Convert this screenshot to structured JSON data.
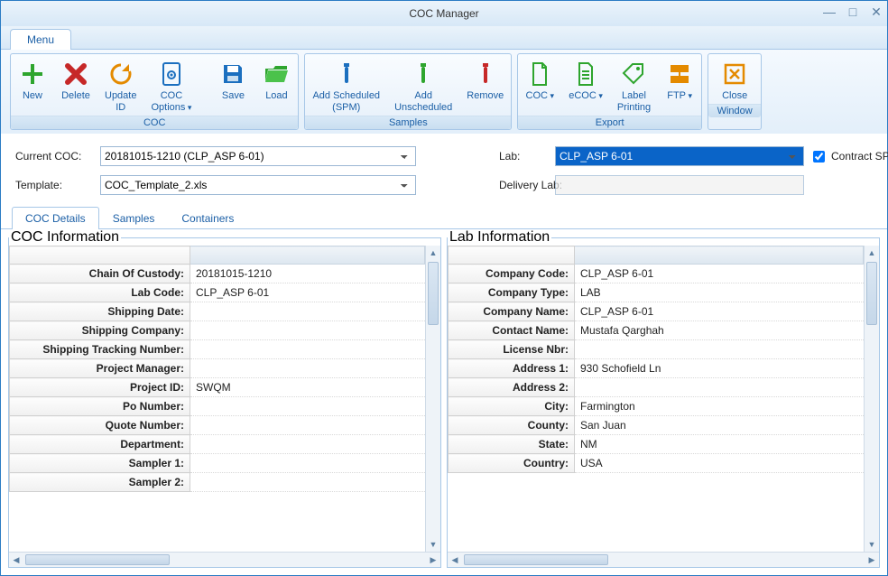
{
  "window": {
    "title": "COC Manager"
  },
  "menu": {
    "tab": "Menu"
  },
  "ribbon": {
    "groups": {
      "coc": {
        "label": "COC",
        "new": "New",
        "delete": "Delete",
        "update_id": "Update\nID",
        "coc_options": "COC\nOptions",
        "save": "Save",
        "load": "Load"
      },
      "samples": {
        "label": "Samples",
        "add_scheduled": "Add Scheduled\n(SPM)",
        "add_unscheduled": "Add\nUnscheduled",
        "remove": "Remove"
      },
      "export": {
        "label": "Export",
        "coc": "COC",
        "ecoc": "eCOC",
        "label_printing": "Label\nPrinting",
        "ftp": "FTP"
      },
      "window": {
        "label": "Window",
        "close": "Close"
      }
    }
  },
  "form": {
    "current_coc_label": "Current COC:",
    "current_coc_value": "20181015-1210 (CLP_ASP 6-01)",
    "template_label": "Template:",
    "template_value": "COC_Template_2.xls",
    "lab_label": "Lab:",
    "lab_value": "CLP_ASP 6-01",
    "delivery_lab_label": "Delivery Lab:",
    "delivery_lab_value": "",
    "contract_spm_label": "Contract SPM"
  },
  "tabs": {
    "coc_details": "COC Details",
    "samples": "Samples",
    "containers": "Containers"
  },
  "coc_info": {
    "legend": "COC Information",
    "rows": [
      {
        "label": "Chain Of Custody:",
        "value": "20181015-1210"
      },
      {
        "label": "Lab Code:",
        "value": "CLP_ASP 6-01"
      },
      {
        "label": "Shipping Date:",
        "value": ""
      },
      {
        "label": "Shipping Company:",
        "value": ""
      },
      {
        "label": "Shipping Tracking Number:",
        "value": ""
      },
      {
        "label": "Project Manager:",
        "value": ""
      },
      {
        "label": "Project ID:",
        "value": "SWQM"
      },
      {
        "label": "Po Number:",
        "value": ""
      },
      {
        "label": "Quote Number:",
        "value": ""
      },
      {
        "label": "Department:",
        "value": ""
      },
      {
        "label": "Sampler 1:",
        "value": ""
      },
      {
        "label": "Sampler 2:",
        "value": ""
      }
    ]
  },
  "lab_info": {
    "legend": "Lab Information",
    "rows": [
      {
        "label": "Company Code:",
        "value": "CLP_ASP 6-01"
      },
      {
        "label": "Company Type:",
        "value": "LAB"
      },
      {
        "label": "Company Name:",
        "value": "CLP_ASP 6-01"
      },
      {
        "label": "Contact Name:",
        "value": "Mustafa Qarghah"
      },
      {
        "label": "License Nbr:",
        "value": ""
      },
      {
        "label": "Address 1:",
        "value": "930 Schofield Ln"
      },
      {
        "label": "Address 2:",
        "value": ""
      },
      {
        "label": "City:",
        "value": "Farmington"
      },
      {
        "label": "County:",
        "value": "San Juan"
      },
      {
        "label": "State:",
        "value": "NM"
      },
      {
        "label": "Country:",
        "value": "USA"
      }
    ]
  }
}
